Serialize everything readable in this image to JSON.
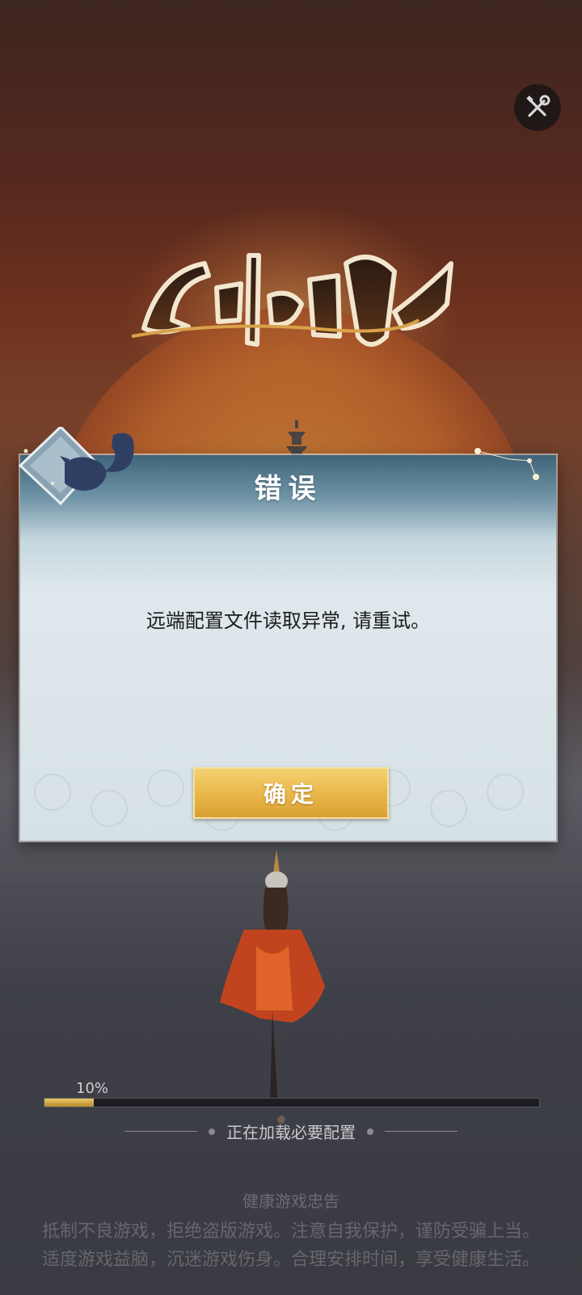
{
  "dialog": {
    "title": "错误",
    "message": "远端配置文件读取异常, 请重试。",
    "ok_label": "确定"
  },
  "loading": {
    "percent_text": "10%",
    "progress": 0.1,
    "status_text": "正在加载必要配置"
  },
  "notice": {
    "title": "健康游戏忠告",
    "lines": [
      "抵制不良游戏，拒绝盗版游戏。注意自我保护，谨防受骗上当。",
      "适度游戏益脑，沉迷游戏伤身。合理安排时间，享受健康生活。"
    ]
  },
  "icons": {
    "settings": "wrench-screwdriver-icon"
  },
  "colors": {
    "button_gold": "#e9b84a",
    "dialog_top": "#3f6378",
    "progress_fill": "#e9c76a"
  }
}
